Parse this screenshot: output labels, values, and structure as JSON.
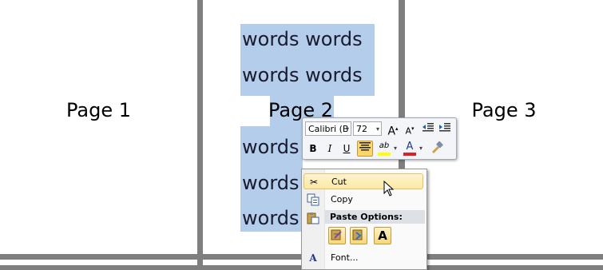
{
  "pages": [
    {
      "label": "Page 1"
    },
    {
      "label": "Page 2"
    },
    {
      "label": "Page 3"
    }
  ],
  "selected_text": {
    "lines": [
      "words words",
      "words words",
      "words",
      "words",
      "words"
    ]
  },
  "mini_toolbar": {
    "font_name": "Calibri (B",
    "font_size": "72",
    "grow_font": "A",
    "shrink_font": "A",
    "bold": "B",
    "italic": "I",
    "underline": "U",
    "highlight": "ab",
    "font_color": "A",
    "highlight_color": "#ffff00",
    "font_color_value": "#e02020"
  },
  "context_menu": {
    "cut": "Cut",
    "copy": "Copy",
    "paste_options_header": "Paste Options:",
    "paste_keep_text": "A",
    "font": "Font..."
  },
  "colors": {
    "selection": "#b3cdeb",
    "workspace": "#7f7f7f",
    "hover_item": "#fde9a4"
  }
}
